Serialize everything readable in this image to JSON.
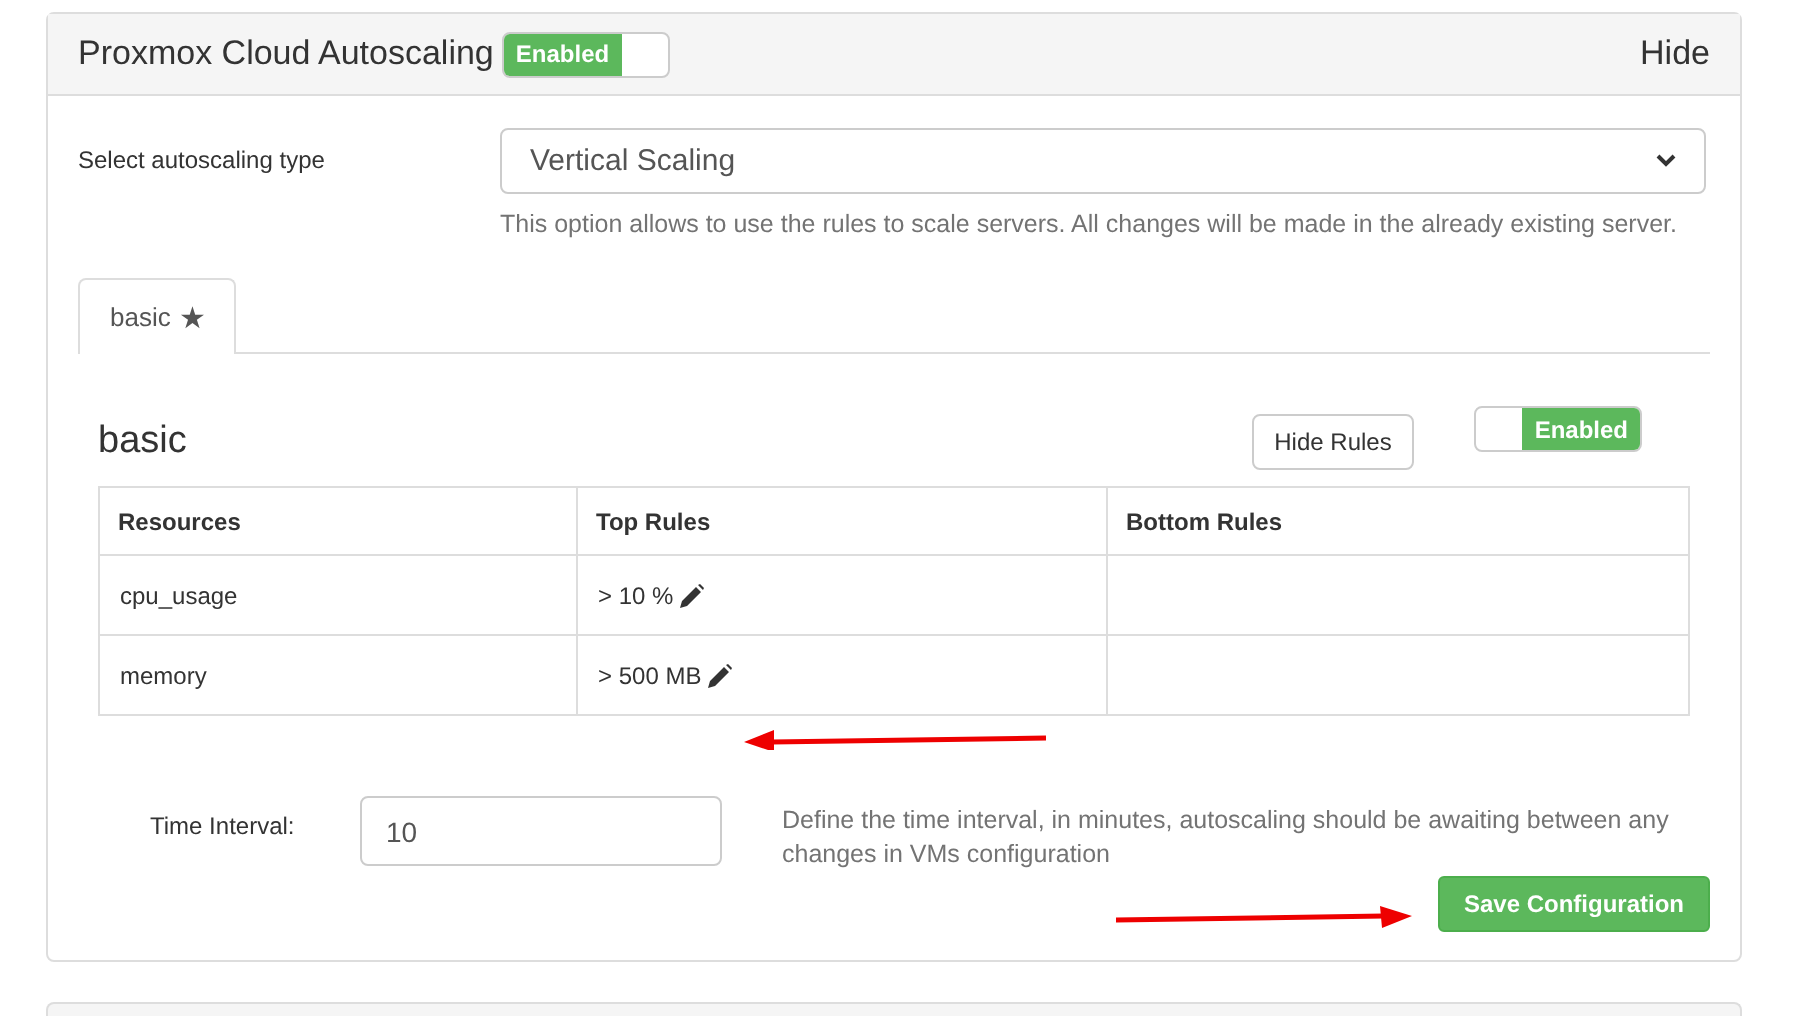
{
  "panel": {
    "title": "Proxmox Cloud Autoscaling",
    "toggle": {
      "label": "Enabled",
      "on": true,
      "kind": "left"
    },
    "hide_link": "Hide"
  },
  "type_select": {
    "label": "Select autoscaling type",
    "value": "Vertical Scaling",
    "help": "This option allows to use the rules to scale servers. All changes will be made in the already existing server."
  },
  "tabs": [
    {
      "label": "basic",
      "icon": "★",
      "selected": true
    }
  ],
  "rule_set": {
    "title": "basic",
    "hide_rules_button": "Hide Rules",
    "toggle": {
      "label": "Enabled",
      "on": true,
      "kind": "right"
    },
    "columns": [
      "Resources",
      "Top Rules",
      "Bottom Rules"
    ],
    "rows": [
      {
        "resource": "cpu_usage",
        "top_rule": "> 10 %"
      },
      {
        "resource": "memory",
        "top_rule": "> 500 MB"
      }
    ]
  },
  "time_interval": {
    "label": "Time Interval:",
    "value": "10",
    "help": "Define the time interval, in minutes, autoscaling should be awaiting between any changes in VMs configuration"
  },
  "save_button": "Save Configuration"
}
